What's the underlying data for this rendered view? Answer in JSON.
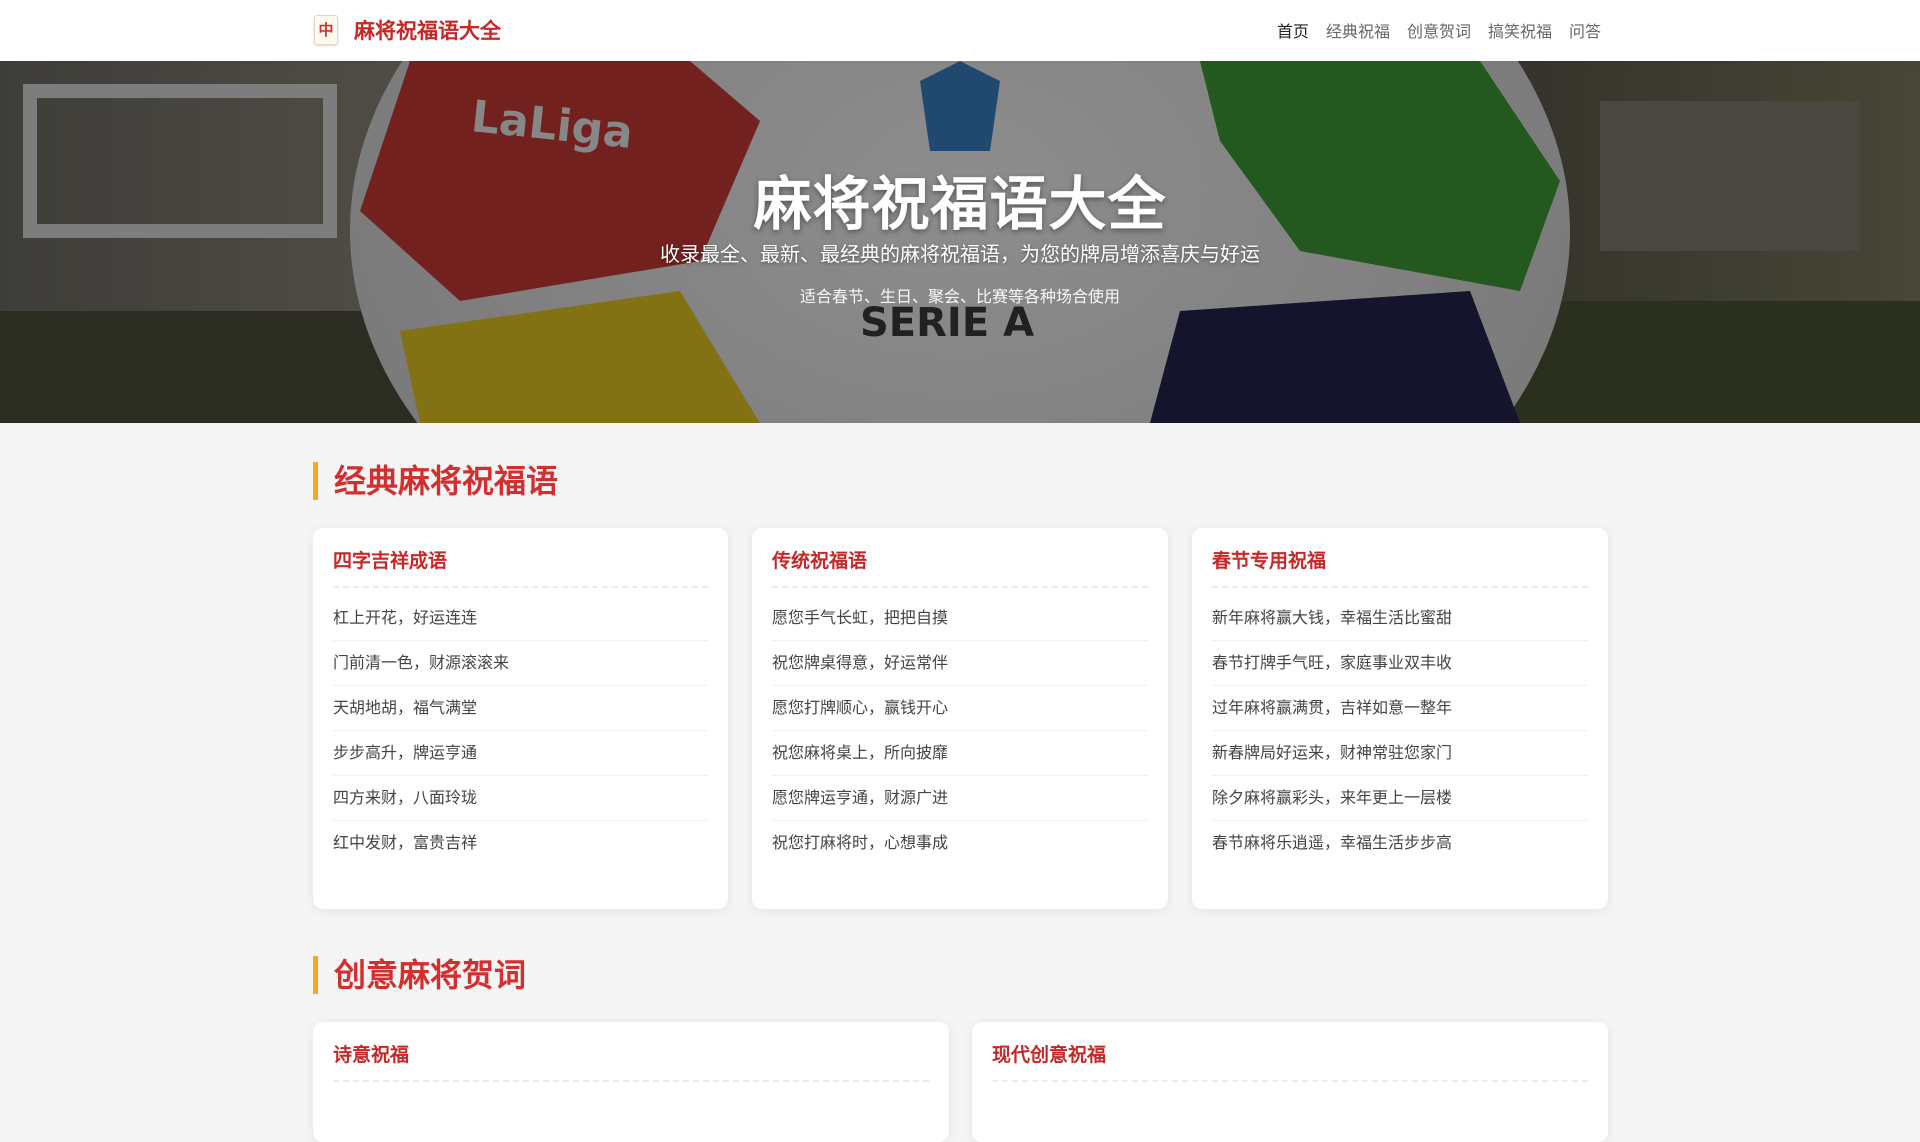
{
  "header": {
    "logo_glyph": "中",
    "title": "麻将祝福语大全",
    "nav": [
      {
        "label": "首页",
        "active": true
      },
      {
        "label": "经典祝福",
        "active": false
      },
      {
        "label": "创意贺词",
        "active": false
      },
      {
        "label": "搞笑祝福",
        "active": false
      },
      {
        "label": "问答",
        "active": false
      }
    ]
  },
  "hero": {
    "title": "麻将祝福语大全",
    "subtitle": "收录最全、最新、最经典的麻将祝福语，为您的牌局增添喜庆与好运",
    "note": "适合春节、生日、聚会、比赛等各种场合使用",
    "background_text": [
      "LaLiga",
      "SERIE A"
    ]
  },
  "sections": [
    {
      "title": "经典麻将祝福语",
      "cards": [
        {
          "title": "四字吉祥成语",
          "items": [
            "杠上开花，好运连连",
            "门前清一色，财源滚滚来",
            "天胡地胡，福气满堂",
            "步步高升，牌运亨通",
            "四方来财，八面玲珑",
            "红中发财，富贵吉祥"
          ]
        },
        {
          "title": "传统祝福语",
          "items": [
            "愿您手气长虹，把把自摸",
            "祝您牌桌得意，好运常伴",
            "愿您打牌顺心，赢钱开心",
            "祝您麻将桌上，所向披靡",
            "愿您牌运亨通，财源广进",
            "祝您打麻将时，心想事成"
          ]
        },
        {
          "title": "春节专用祝福",
          "items": [
            "新年麻将赢大钱，幸福生活比蜜甜",
            "春节打牌手气旺，家庭事业双丰收",
            "过年麻将赢满贯，吉祥如意一整年",
            "新春牌局好运来，财神常驻您家门",
            "除夕麻将赢彩头，来年更上一层楼",
            "春节麻将乐逍遥，幸福生活步步高"
          ]
        }
      ]
    },
    {
      "title": "创意麻将贺词",
      "cards": [
        {
          "title": "诗意祝福",
          "items": []
        },
        {
          "title": "现代创意祝福",
          "items": []
        }
      ]
    }
  ],
  "colors": {
    "accent_red": "#c62828",
    "section_bar": "#f5a623",
    "background": "#f5f5f5"
  }
}
